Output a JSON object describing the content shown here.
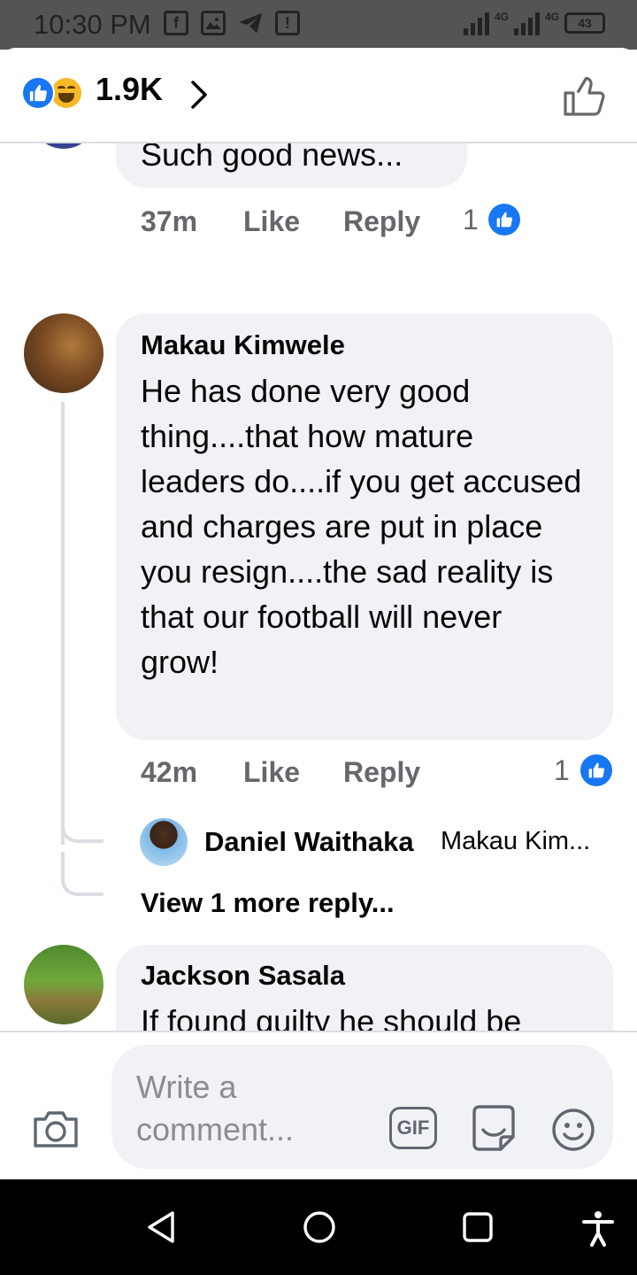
{
  "status_bar": {
    "time": "10:30 PM",
    "notification_icons": [
      "facebook-icon",
      "gallery-icon",
      "telegram-icon",
      "alert-icon"
    ],
    "network_1": "4G",
    "network_2": "4G",
    "battery": "43"
  },
  "header": {
    "reactions": [
      "like",
      "haha"
    ],
    "reaction_count": "1.9K"
  },
  "comments": [
    {
      "text": "Such good news...",
      "time": "37m",
      "like_label": "Like",
      "reply_label": "Reply",
      "reaction_count": "1"
    },
    {
      "author": "Makau Kimwele",
      "text": "He has done very good thing....that how mature leaders do....if you get accused and charges are put in place you resign....the sad reality is that our football will never grow!",
      "time": "42m",
      "like_label": "Like",
      "reply_label": "Reply",
      "reaction_count": "1",
      "reply_preview": {
        "author": "Daniel Waithaka",
        "snippet": "Makau Kim..."
      },
      "view_more": "View 1 more reply..."
    },
    {
      "author": "Jackson Sasala",
      "text": "If found guilty he should be jailed for misappropriation"
    }
  ],
  "composer": {
    "placeholder": "Write a comment...",
    "gif_label": "GIF"
  },
  "colors": {
    "accent": "#1877f2",
    "bubble": "#f0f2f5",
    "muted_text": "#65676b"
  }
}
